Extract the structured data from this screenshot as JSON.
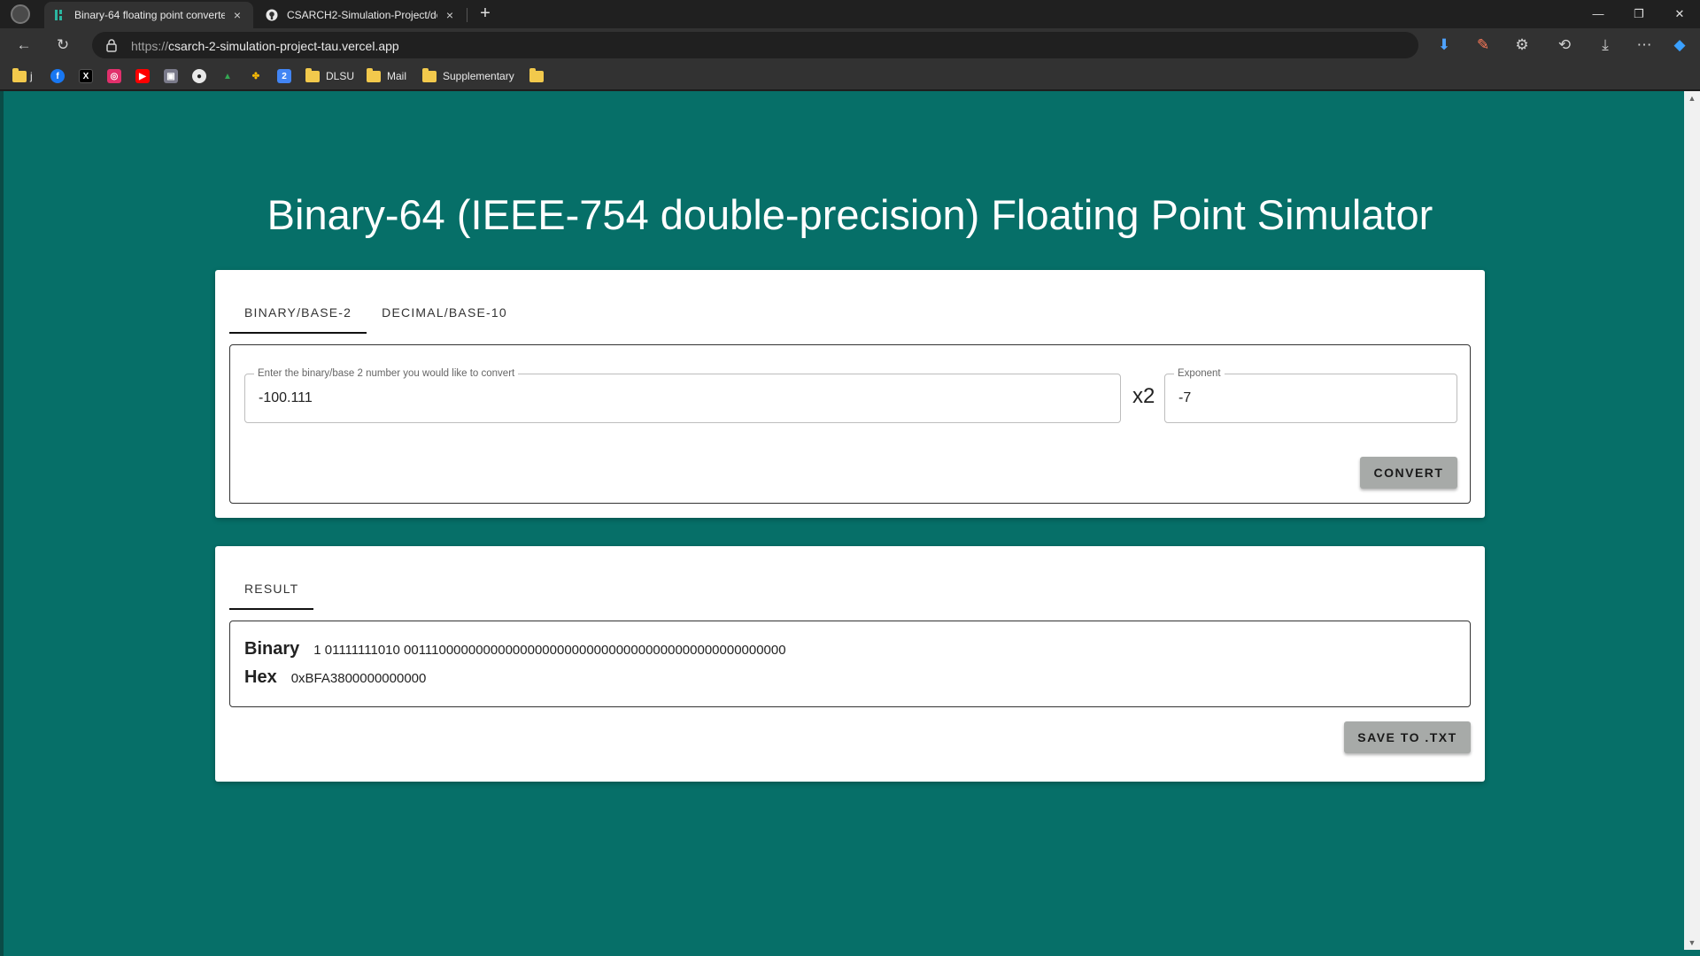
{
  "browser": {
    "tabs": [
      {
        "title": "Binary-64 floating point converte",
        "favicon": "teal-grid-icon",
        "close": "×"
      },
      {
        "title": "CSARCH2-Simulation-Project/do",
        "favicon": "github-icon",
        "close": "×"
      }
    ],
    "new_tab": "+",
    "url_protocol": "https://",
    "url_host": "csarch-2-simulation-project-tau.vercel.app",
    "bookmarks": [
      {
        "label": "j",
        "icon": "folder-icon"
      },
      {
        "label": "",
        "icon": "facebook-icon"
      },
      {
        "label": "",
        "icon": "x-icon"
      },
      {
        "label": "",
        "icon": "instagram-icon"
      },
      {
        "label": "",
        "icon": "youtube-icon"
      },
      {
        "label": "",
        "icon": "lock-bookmark-icon"
      },
      {
        "label": "",
        "icon": "github-icon"
      },
      {
        "label": "",
        "icon": "drive-icon"
      },
      {
        "label": "",
        "icon": "pinwheel-icon"
      },
      {
        "label": "",
        "icon": "calendar-icon"
      },
      {
        "label": "DLSU",
        "icon": "folder-icon"
      },
      {
        "label": "Mail",
        "icon": "folder-icon"
      },
      {
        "label": "Supplementary",
        "icon": "folder-icon"
      },
      {
        "label": "",
        "icon": "folder-icon"
      }
    ]
  },
  "page": {
    "title": "Binary-64 (IEEE-754 double-precision) Floating Point Simulator",
    "input_tabs": [
      "BINARY/BASE-2",
      "DECIMAL/BASE-10"
    ],
    "active_input_tab": "BINARY/BASE-2",
    "binary_field": {
      "label": "Enter the binary/base 2 number you would like to convert",
      "value": "-100.111"
    },
    "times_label": "x2",
    "exponent_field": {
      "label": "Exponent",
      "value": "-7"
    },
    "convert_label": "CONVERT",
    "result_tab": "RESULT",
    "result": {
      "binary_label": "Binary",
      "binary_value": "1 01111111010 0011100000000000000000000000000000000000000000000000",
      "hex_label": "Hex",
      "hex_value": "0xBFA3800000000000"
    },
    "save_label": "SAVE TO .TXT"
  },
  "colors": {
    "page_bg": "#066f68",
    "button_bg": "#a7aaa8"
  }
}
